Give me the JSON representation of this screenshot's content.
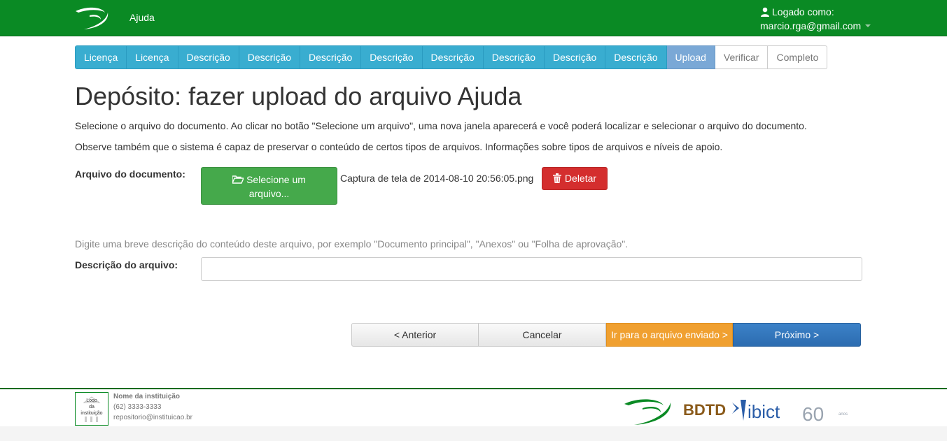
{
  "header": {
    "help_label": "Ajuda",
    "logged_label": "Logado como:",
    "user_email": "marcio.rga@gmail.com"
  },
  "steps": [
    "Licença",
    "Licença",
    "Descrição",
    "Descrição",
    "Descrição",
    "Descrição",
    "Descrição",
    "Descrição",
    "Descrição",
    "Descrição",
    "Upload",
    "Verificar",
    "Completo"
  ],
  "page": {
    "title": "Depósito: fazer upload do arquivo Ajuda",
    "intro1": "Selecione o arquivo do documento. Ao clicar no botão \"Selecione um arquivo\", uma nova janela aparecerá e você poderá localizar e selecionar o arquivo do documento.",
    "intro2": "Observe também que o sistema é capaz de preservar o conteúdo de certos tipos de arquivos. Informações sobre tipos de arquivos e níveis de apoio."
  },
  "file": {
    "label": "Arquivo do documento:",
    "select_line1": "Selecione um",
    "select_line2": "arquivo...",
    "filename": "Captura de tela de 2014-08-10 20:56:05.png",
    "delete_label": "Deletar"
  },
  "description": {
    "hint": "Digite uma breve descrição do conteúdo deste arquivo, por exemplo \"Documento principal\", \"Anexos\" ou \"Folha de aprovação\".",
    "label": "Descrição do arquivo:",
    "value": ""
  },
  "actions": {
    "prev": "< Anterior",
    "cancel": "Cancelar",
    "go_file": "Ir para o arquivo enviado >",
    "next": "Próximo >"
  },
  "footer": {
    "logo_line1": "Logo",
    "logo_line2": "da",
    "logo_line3": "instituição",
    "inst_name": "Nome da instituição",
    "phone": "(62) 3333-3333",
    "email": "repositorio@instituicao.br",
    "partner_bdtd": "BDTD",
    "partner_ibict": "ibict",
    "partner_60": "60",
    "partner_anos": "anos"
  },
  "colors": {
    "header_green": "#0a8a24",
    "step_blue": "#39add0",
    "select_green": "#45a94b",
    "delete_red": "#d42e2e",
    "go_orange": "#f0a030",
    "next_blue": "#2c6cb0"
  }
}
